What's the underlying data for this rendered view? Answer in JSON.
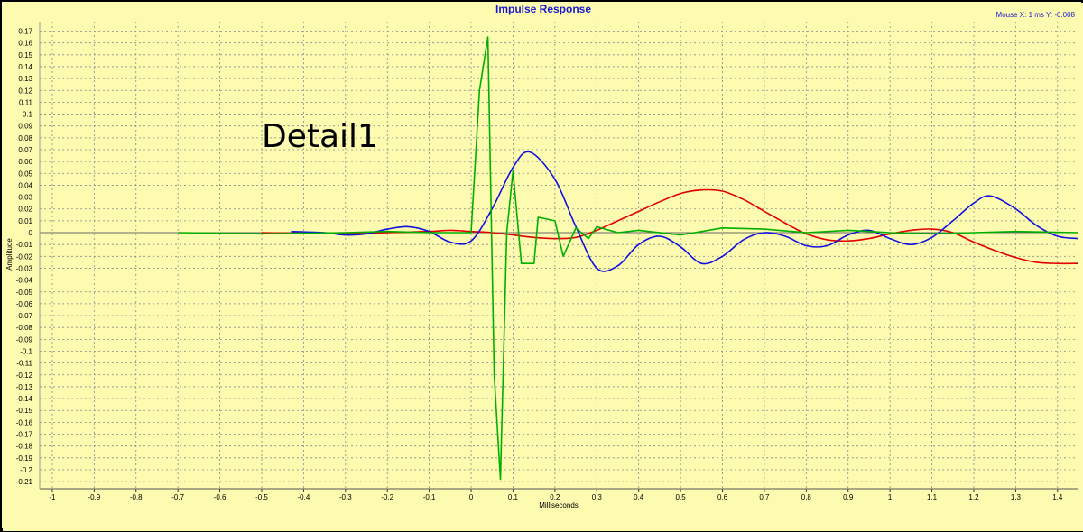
{
  "chart_data": {
    "type": "line",
    "title": "Impulse Response",
    "mouse_readout": "Mouse X: 1 ms   Y: -0.008",
    "annotation": "Detail1",
    "xlabel": "Milliseconds",
    "ylabel": "Amplitude",
    "xlim": [
      -1.03,
      1.45
    ],
    "ylim": [
      -0.216,
      0.178
    ],
    "x_ticks": [
      -1,
      -0.9,
      -0.8,
      -0.7,
      -0.6,
      -0.5,
      -0.4,
      -0.3,
      -0.2,
      -0.1,
      0,
      0.1,
      0.2,
      0.3,
      0.4,
      0.5,
      0.6,
      0.7,
      0.8,
      0.9,
      1,
      1.1,
      1.2,
      1.3,
      1.4
    ],
    "y_ticks": [
      0.17,
      0.16,
      0.15,
      0.14,
      0.13,
      0.12,
      0.11,
      0.1,
      0.09,
      0.08,
      0.07,
      0.06,
      0.05,
      0.04,
      0.03,
      0.02,
      0.01,
      0,
      -0.01,
      -0.02,
      -0.03,
      -0.04,
      -0.05,
      -0.06,
      -0.07,
      -0.08,
      -0.09,
      -0.1,
      -0.11,
      -0.12,
      -0.13,
      -0.14,
      -0.15,
      -0.16,
      -0.17,
      -0.18,
      -0.19,
      -0.2,
      -0.21
    ],
    "grid": true,
    "series": [
      {
        "color": "#e00000",
        "x": [
          -0.5,
          -0.3,
          -0.2,
          -0.1,
          -0.05,
          0,
          0.05,
          0.1,
          0.15,
          0.2,
          0.25,
          0.3,
          0.35,
          0.4,
          0.45,
          0.5,
          0.55,
          0.6,
          0.65,
          0.7,
          0.75,
          0.8,
          0.85,
          0.9,
          0.95,
          1.0,
          1.05,
          1.1,
          1.15,
          1.2,
          1.25,
          1.3,
          1.35,
          1.4,
          1.45
        ],
        "y": [
          0.0,
          -0.001,
          0.0,
          0.001,
          0.002,
          0.001,
          0.0,
          -0.002,
          -0.004,
          -0.005,
          -0.004,
          0.002,
          0.01,
          0.018,
          0.026,
          0.033,
          0.036,
          0.035,
          0.028,
          0.018,
          0.008,
          -0.001,
          -0.006,
          -0.007,
          -0.005,
          -0.001,
          0.002,
          0.003,
          0.0,
          -0.008,
          -0.015,
          -0.021,
          -0.025,
          -0.026,
          -0.026
        ]
      },
      {
        "color": "#1010e0",
        "x": [
          -0.43,
          -0.35,
          -0.3,
          -0.25,
          -0.2,
          -0.15,
          -0.1,
          -0.05,
          0,
          0.05,
          0.1,
          0.14,
          0.2,
          0.25,
          0.3,
          0.35,
          0.4,
          0.45,
          0.5,
          0.55,
          0.6,
          0.65,
          0.7,
          0.75,
          0.8,
          0.85,
          0.9,
          0.95,
          1.0,
          1.05,
          1.1,
          1.15,
          1.2,
          1.24,
          1.3,
          1.35,
          1.4,
          1.45
        ],
        "y": [
          0.001,
          0.0,
          -0.002,
          -0.001,
          0.003,
          0.005,
          0.001,
          -0.008,
          -0.007,
          0.02,
          0.055,
          0.068,
          0.045,
          0.005,
          -0.03,
          -0.028,
          -0.01,
          -0.003,
          -0.012,
          -0.026,
          -0.02,
          -0.006,
          0.0,
          -0.003,
          -0.011,
          -0.011,
          -0.002,
          0.002,
          -0.005,
          -0.01,
          -0.004,
          0.01,
          0.025,
          0.031,
          0.02,
          0.006,
          -0.003,
          -0.005
        ]
      },
      {
        "color": "#00b000",
        "x": [
          -0.7,
          -0.5,
          -0.3,
          -0.2,
          -0.1,
          -0.03,
          0.0,
          0.02,
          0.04,
          0.055,
          0.07,
          0.085,
          0.1,
          0.12,
          0.15,
          0.16,
          0.2,
          0.22,
          0.25,
          0.28,
          0.3,
          0.32,
          0.35,
          0.4,
          0.5,
          0.6,
          0.7,
          0.8,
          0.9,
          0.95,
          1.0,
          1.1,
          1.2,
          1.3,
          1.45
        ],
        "y": [
          0.0,
          -0.001,
          0.0,
          0.001,
          0.0,
          0.0,
          0.0,
          0.12,
          0.165,
          -0.12,
          -0.208,
          0.0,
          0.052,
          -0.026,
          -0.026,
          0.013,
          0.01,
          -0.02,
          0.004,
          -0.005,
          0.005,
          0.003,
          0.0,
          0.002,
          -0.002,
          0.004,
          0.003,
          0.0,
          0.002,
          0.001,
          0.0,
          -0.001,
          0.0,
          0.001,
          0.0
        ]
      }
    ]
  }
}
